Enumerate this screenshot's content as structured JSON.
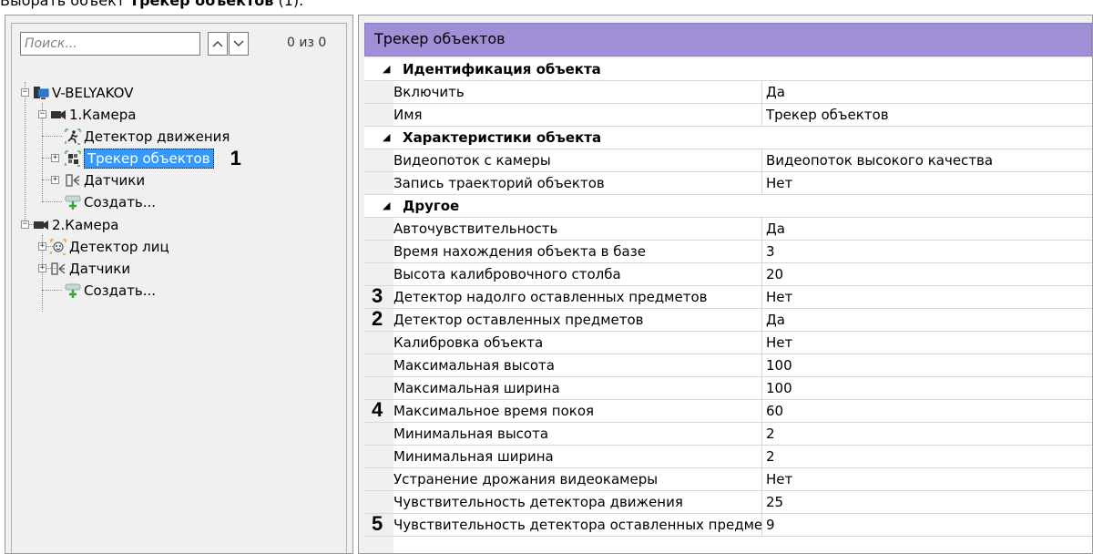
{
  "caption": {
    "prefix": "Выбрать объект ",
    "bold": "Трекер объектов",
    "suffix": " (1)."
  },
  "search": {
    "placeholder": "Поиск...",
    "value": "",
    "count": "0 из 0"
  },
  "tree": {
    "server": "V-BELYAKOV",
    "camera1": "1.Камера",
    "motion_detector": "Детектор движения",
    "object_tracker": "Трекер объектов",
    "object_tracker_callout": "1",
    "sensors1": "Датчики",
    "create1": "Создать...",
    "camera2": "2.Камера",
    "face_detector": "Детектор лиц",
    "sensors2": "Датчики",
    "create2": "Создать..."
  },
  "panel": {
    "title": "Трекер объектов",
    "rows": [
      {
        "type": "cat",
        "name": "Идентификация объекта",
        "value": ""
      },
      {
        "type": "prop",
        "name": "Включить",
        "value": "Да",
        "callout": ""
      },
      {
        "type": "prop",
        "name": "Имя",
        "value": "Трекер объектов",
        "callout": ""
      },
      {
        "type": "cat",
        "name": "Характеристики объекта",
        "value": ""
      },
      {
        "type": "prop",
        "name": "Видеопоток с камеры",
        "value": "Видеопоток высокого качества",
        "callout": ""
      },
      {
        "type": "prop",
        "name": "Запись траекторий объектов",
        "value": "Нет",
        "callout": ""
      },
      {
        "type": "cat",
        "name": "Другое",
        "value": ""
      },
      {
        "type": "prop",
        "name": "Авточувствительность",
        "value": "Да",
        "callout": ""
      },
      {
        "type": "prop",
        "name": "Время нахождения объекта в базе",
        "value": "3",
        "callout": ""
      },
      {
        "type": "prop",
        "name": "Высота калибровочного столба",
        "value": "20",
        "callout": ""
      },
      {
        "type": "prop",
        "name": "Детектор надолго оставленных предметов",
        "value": "Нет",
        "callout": "3"
      },
      {
        "type": "prop",
        "name": "Детектор оставленных предметов",
        "value": "Да",
        "callout": "2"
      },
      {
        "type": "prop",
        "name": "Калибровка объекта",
        "value": "Нет",
        "callout": ""
      },
      {
        "type": "prop",
        "name": "Максимальная высота",
        "value": "100",
        "callout": ""
      },
      {
        "type": "prop",
        "name": "Максимальная ширина",
        "value": "100",
        "callout": ""
      },
      {
        "type": "prop",
        "name": "Максимальное время покоя",
        "value": "60",
        "callout": "4"
      },
      {
        "type": "prop",
        "name": "Минимальная высота",
        "value": "2",
        "callout": ""
      },
      {
        "type": "prop",
        "name": "Минимальная ширина",
        "value": "2",
        "callout": ""
      },
      {
        "type": "prop",
        "name": "Устранение дрожания видеокамеры",
        "value": "Нет",
        "callout": ""
      },
      {
        "type": "prop",
        "name": "Чувствительность детектора движения",
        "value": "25",
        "callout": ""
      },
      {
        "type": "prop",
        "name": "Чувствительность детектора оставленных предметов",
        "value": "9",
        "callout": "5"
      }
    ]
  }
}
